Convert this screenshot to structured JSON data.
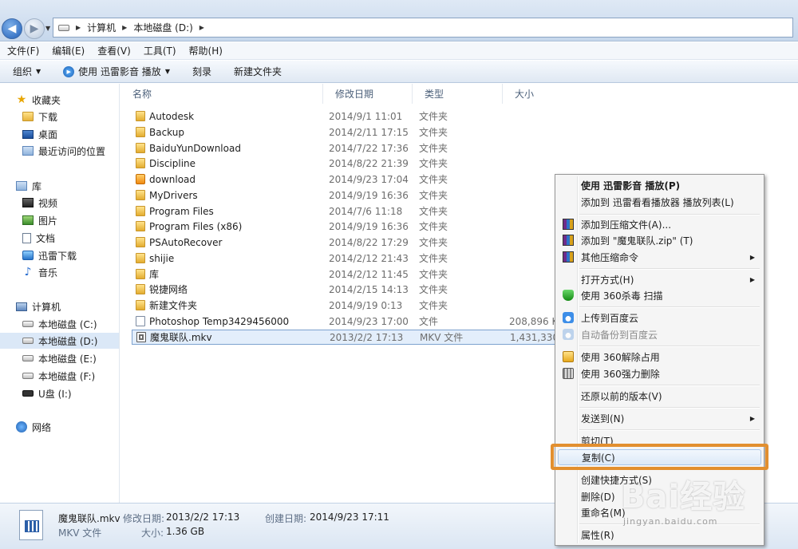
{
  "address": {
    "crumbs": [
      "计算机",
      "本地磁盘 (D:)"
    ]
  },
  "menubar": [
    "文件(F)",
    "编辑(E)",
    "查看(V)",
    "工具(T)",
    "帮助(H)"
  ],
  "toolbar": {
    "organize": "组织",
    "play_with": "使用 迅雷影音 播放",
    "burn": "刻录",
    "new_folder": "新建文件夹"
  },
  "sidebar": {
    "favorites": "收藏夹",
    "fav_items": [
      "下载",
      "桌面",
      "最近访问的位置"
    ],
    "libraries": "库",
    "lib_items": [
      "视频",
      "图片",
      "文档",
      "迅雷下载",
      "音乐"
    ],
    "computer": "计算机",
    "drives": [
      "本地磁盘 (C:)",
      "本地磁盘 (D:)",
      "本地磁盘 (E:)",
      "本地磁盘 (F:)",
      "U盘 (I:)"
    ],
    "network": "网络"
  },
  "columns": {
    "name": "名称",
    "date": "修改日期",
    "type": "类型",
    "size": "大小"
  },
  "files": [
    {
      "name": "Autodesk",
      "date": "2014/9/1 11:01",
      "type": "文件夹",
      "size": ""
    },
    {
      "name": "Backup",
      "date": "2014/2/11 17:15",
      "type": "文件夹",
      "size": ""
    },
    {
      "name": "BaiduYunDownload",
      "date": "2014/7/22 17:36",
      "type": "文件夹",
      "size": ""
    },
    {
      "name": "Discipline",
      "date": "2014/8/22 21:39",
      "type": "文件夹",
      "size": ""
    },
    {
      "name": "download",
      "date": "2014/9/23 17:04",
      "type": "文件夹",
      "size": ""
    },
    {
      "name": "MyDrivers",
      "date": "2014/9/19 16:36",
      "type": "文件夹",
      "size": ""
    },
    {
      "name": "Program Files",
      "date": "2014/7/6 11:18",
      "type": "文件夹",
      "size": ""
    },
    {
      "name": "Program Files (x86)",
      "date": "2014/9/19 16:36",
      "type": "文件夹",
      "size": ""
    },
    {
      "name": "PSAutoRecover",
      "date": "2014/8/22 17:29",
      "type": "文件夹",
      "size": ""
    },
    {
      "name": "shijie",
      "date": "2014/2/12 21:43",
      "type": "文件夹",
      "size": ""
    },
    {
      "name": "库",
      "date": "2014/2/12 11:45",
      "type": "文件夹",
      "size": ""
    },
    {
      "name": "锐捷网络",
      "date": "2014/2/15 14:13",
      "type": "文件夹",
      "size": ""
    },
    {
      "name": "新建文件夹",
      "date": "2014/9/19 0:13",
      "type": "文件夹",
      "size": ""
    },
    {
      "name": "Photoshop Temp3429456000",
      "date": "2014/9/23 17:00",
      "type": "文件",
      "size": "208,896 KB"
    },
    {
      "name": "魔鬼联队.mkv",
      "date": "2013/2/2 17:13",
      "type": "MKV 文件",
      "size": "1,431,330..."
    }
  ],
  "status": {
    "filename": "魔鬼联队.mkv",
    "modified_label": "修改日期:",
    "modified": "2013/2/2 17:13",
    "created_label": "创建日期:",
    "created": "2014/9/23 17:11",
    "type": "MKV 文件",
    "size_label": "大小:",
    "size": "1.36 GB"
  },
  "context_menu": {
    "play": "使用 迅雷影音 播放(P)",
    "add_playlist": "添加到 迅雷看看播放器 播放列表(L)",
    "add_archive": "添加到压缩文件(A)...",
    "add_zip": "添加到 \"魔鬼联队.zip\" (T)",
    "other_compress": "其他压缩命令",
    "open_with": "打开方式(H)",
    "scan_360": "使用 360杀毒 扫描",
    "upload_baidu": "上传到百度云",
    "auto_backup": "自动备份到百度云",
    "unlock_360": "使用 360解除占用",
    "force_delete": "使用 360强力删除",
    "restore": "还原以前的版本(V)",
    "send_to": "发送到(N)",
    "cut": "剪切(T)",
    "copy": "复制(C)",
    "shortcut": "创建快捷方式(S)",
    "delete": "删除(D)",
    "rename": "重命名(M)",
    "properties": "属性(R)"
  },
  "watermark": {
    "brand": "Bai经验",
    "url": "jingyan.baidu.com"
  },
  "colors": {
    "highlight": "#e28f2f",
    "selection": "#e3eefb"
  }
}
